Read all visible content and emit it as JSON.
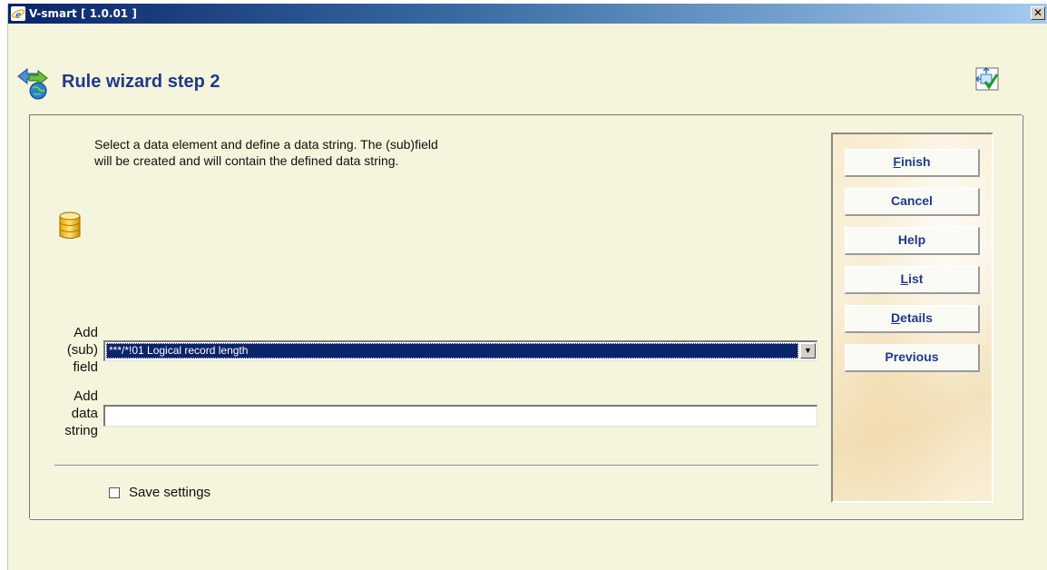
{
  "window": {
    "title": "V-smart [ 1.0.01 ]",
    "close_glyph": "✕"
  },
  "header": {
    "title": "Rule wizard step 2",
    "icon": "rule-wizard-icon",
    "right_icon": "settings-icon"
  },
  "content": {
    "description_line1": "Select a data element and define a data string. The (sub)field",
    "description_line2": "will be created and will contain the defined data string.",
    "add_subfield_label": [
      "Add",
      "(sub)",
      "field"
    ],
    "add_subfield_value": "***/*!01 Logical record length",
    "add_data_string_label": [
      "Add",
      "data",
      "string"
    ],
    "add_data_string_value": "",
    "save_settings_label": "Save settings",
    "save_settings_checked": false
  },
  "buttons": {
    "finish": {
      "underlined": "F",
      "rest": "inish"
    },
    "cancel": {
      "label": "Cancel"
    },
    "help": {
      "label": "Help"
    },
    "list": {
      "underlined": "L",
      "rest": "ist"
    },
    "details": {
      "underlined": "D",
      "rest": "etails"
    },
    "previous": {
      "label": "Previous"
    }
  },
  "colors": {
    "window_background": "#f5f4dc",
    "title_color": "#1f3a8a",
    "selection_background": "#0a246a"
  }
}
